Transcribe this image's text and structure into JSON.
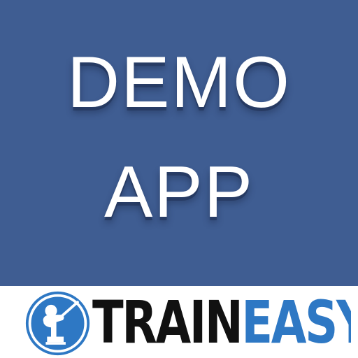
{
  "title": {
    "line1": "DEMO",
    "line2": "APP"
  },
  "brand": {
    "part1": "TRAIN",
    "part2": "EASY",
    "logo_icon": "teacher-pointer-icon"
  },
  "colors": {
    "panel_background": "#3f5d92",
    "title_text": "#ffffff",
    "brand_black": "#111111",
    "brand_blue": "#2e78c4"
  }
}
